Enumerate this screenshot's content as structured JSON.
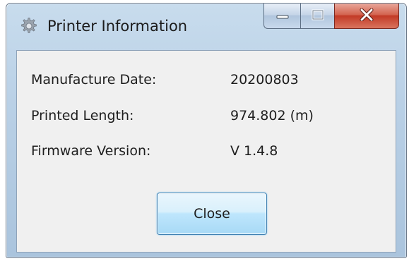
{
  "window": {
    "title": "Printer Information",
    "icon": "gear-icon"
  },
  "fields": [
    {
      "label": "Manufacture Date:",
      "value": "20200803"
    },
    {
      "label": "Printed Length:",
      "value": "974.802 (m)"
    },
    {
      "label": "Firmware Version:",
      "value": "V 1.4.8"
    }
  ],
  "buttons": {
    "close_label": "Close"
  },
  "title_controls": [
    "minimize-icon",
    "maximize-icon",
    "close-icon"
  ],
  "colors": {
    "close_button_red": "#c23a26",
    "dialog_background": "#f0f0f0",
    "button_focus_border": "#3c7fb1"
  }
}
